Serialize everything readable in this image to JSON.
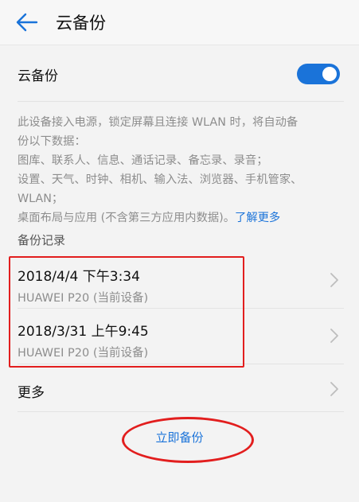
{
  "header": {
    "title": "云备份"
  },
  "cloud_backup": {
    "label": "云备份",
    "enabled": true
  },
  "description": {
    "lines": [
      "此设备接入电源，锁定屏幕且连接 WLAN 时，将自动备",
      "份以下数据：",
      "图库、联系人、信息、通话记录、备忘录、录音；",
      "设置、天气、时钟、相机、输入法、浏览器、手机管家、",
      "WLAN；",
      "桌面布局与应用 (不含第三方应用内数据)。"
    ],
    "learn_more": "了解更多"
  },
  "backup_records": {
    "header": "备份记录",
    "items": [
      {
        "date": "2018/4/4 下午3:34",
        "device": "HUAWEI P20 (当前设备)"
      },
      {
        "date": "2018/3/31 上午9:45",
        "device": "HUAWEI P20 (当前设备)"
      }
    ]
  },
  "more": {
    "label": "更多"
  },
  "backup_now": {
    "label": "立即备份"
  },
  "colors": {
    "accent": "#1a73d9",
    "annotation": "#e21e1e"
  }
}
